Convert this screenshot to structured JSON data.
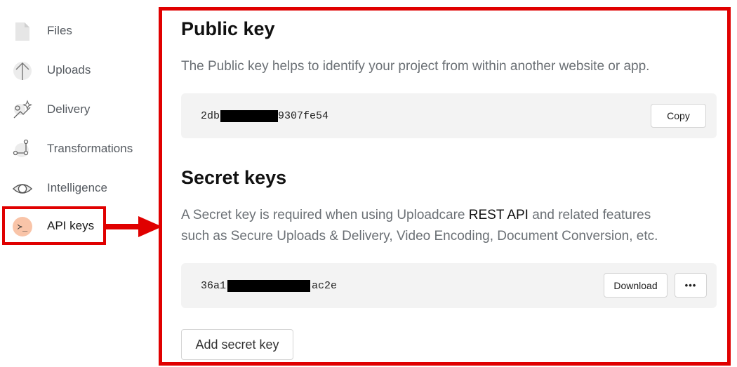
{
  "sidebar": {
    "items": [
      {
        "label": "Files",
        "icon": "file-icon"
      },
      {
        "label": "Uploads",
        "icon": "upload-arrow-icon"
      },
      {
        "label": "Delivery",
        "icon": "delivery-sparkle-icon"
      },
      {
        "label": "Transformations",
        "icon": "transform-nodes-icon"
      },
      {
        "label": "Intelligence",
        "icon": "eye-icon"
      },
      {
        "label": "API keys",
        "icon": "terminal-prompt-icon",
        "active": true
      }
    ],
    "api_icon_glyph": "≻_"
  },
  "public_key": {
    "title": "Public key",
    "description": "The Public key helps to identify your project from within another website or app.",
    "key_prefix": "2db6",
    "key_suffix": "9307fe54",
    "copy_label": "Copy"
  },
  "secret_keys": {
    "title": "Secret keys",
    "desc_before": "A Secret key is required when using Uploadcare ",
    "desc_link": "REST API",
    "desc_after": " and related features",
    "desc_line2": "such as Secure Uploads & Delivery, Video Encoding, Document Conversion, etc.",
    "key_prefix": "36a1",
    "key_suffix": "ac2e",
    "download_label": "Download",
    "more_label": "•••",
    "add_label": "Add secret key"
  },
  "colors": {
    "highlight": "#e00000",
    "api_icon_bg": "#f9c4a8",
    "key_box_bg": "#f3f3f3"
  }
}
